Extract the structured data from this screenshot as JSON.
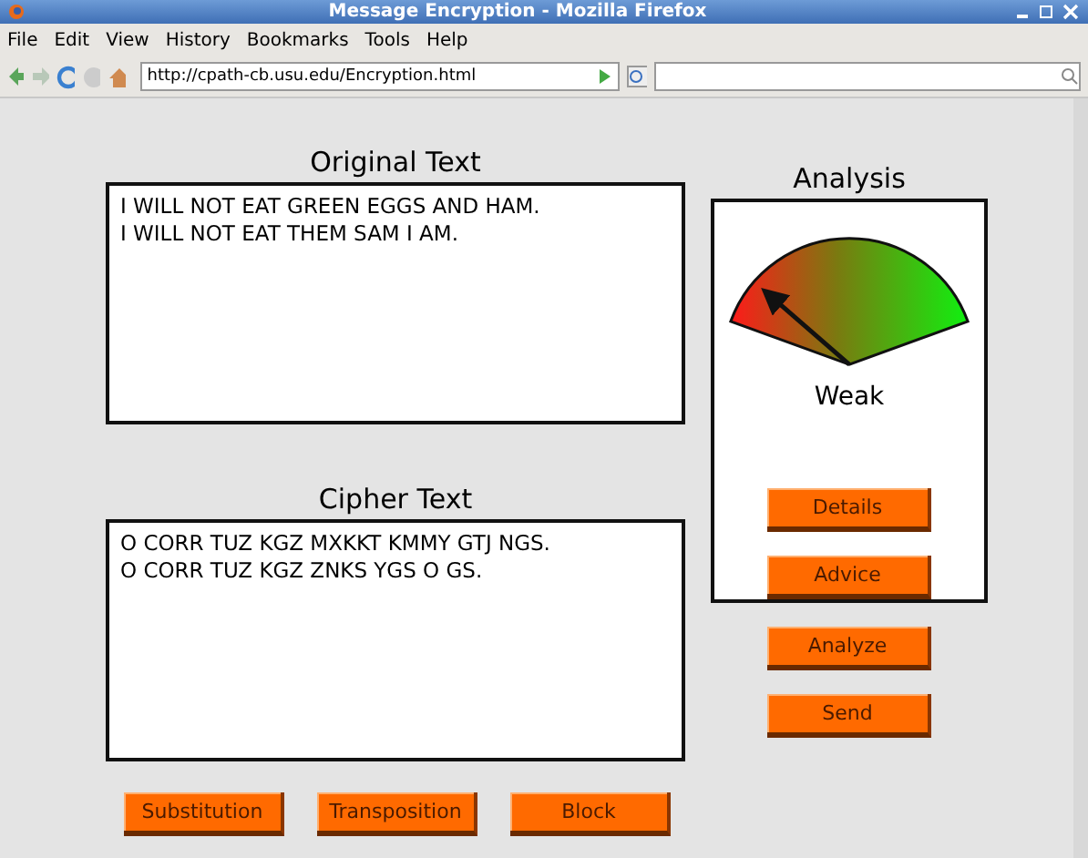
{
  "window": {
    "title": "Message Encryption - Mozilla Firefox"
  },
  "menu": [
    "File",
    "Edit",
    "View",
    "History",
    "Bookmarks",
    "Tools",
    "Help"
  ],
  "address": {
    "value": "http://cpath-cb.usu.edu/Encryption.html"
  },
  "original": {
    "title": "Original Text",
    "lines": [
      "I WILL NOT EAT GREEN EGGS AND HAM.",
      "I WILL NOT EAT THEM SAM I AM."
    ]
  },
  "cipher": {
    "title": "Cipher Text",
    "lines": [
      "O CORR TUZ KGZ MXKKT KMMY GTJ NGS.",
      "O CORR TUZ KGZ ZNKS YGS O GS."
    ]
  },
  "method_buttons": [
    "Substitution",
    "Transposition",
    "Block"
  ],
  "analysis": {
    "title": "Analysis",
    "gauge": {
      "reading": "Weak"
    },
    "buttons": [
      "Details",
      "Advice"
    ]
  },
  "action_buttons": [
    "Analyze",
    "Send"
  ]
}
